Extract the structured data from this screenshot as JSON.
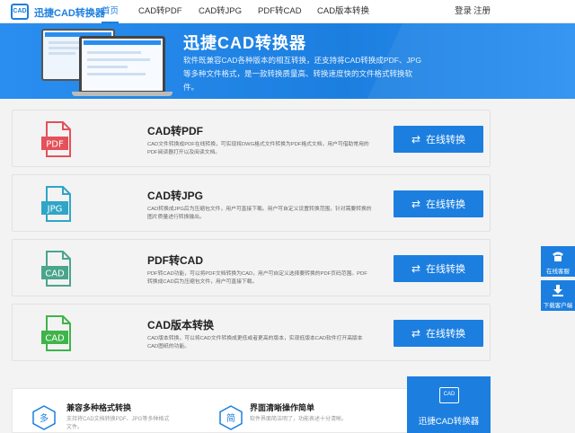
{
  "nav": {
    "logo_icon": "CAD",
    "logo_text": "迅捷CAD转换器",
    "items": [
      {
        "label": "首页",
        "active": true
      },
      {
        "label": "CAD转PDF"
      },
      {
        "label": "CAD转JPG"
      },
      {
        "label": "PDF转CAD"
      },
      {
        "label": "CAD版本转换"
      }
    ],
    "login": "登录",
    "register": "注册"
  },
  "hero": {
    "title": "迅捷CAD转换器",
    "description": "软件既兼容CAD各种版本的相互转换，还支持将CAD转换成PDF、JPG等多种文件格式，是一款转换质量高、转换速度快的文件格式转换软件。"
  },
  "cards": [
    {
      "icon_label": "PDF",
      "icon_color": "#e5505a",
      "title": "CAD转PDF",
      "description": "CAD文件转换成PDF在线转换，可实现将DWG格式文件转换为PDF格式文档，用户可借助常用的PDF阅读器打开以及阅读文档。",
      "button": "在线转换"
    },
    {
      "icon_label": "JPG",
      "icon_color": "#2fa6c6",
      "title": "CAD转JPG",
      "description": "CAD转换成JPG后为压缩包文件，用户可直接下载。用户可自定义设置转换范围，针对需要转换的图片质量进行转换输出。",
      "button": "在线转换"
    },
    {
      "icon_label": "CAD",
      "icon_color": "#4aa58c",
      "title": "PDF转CAD",
      "description": "PDF转CAD功能，可以将PDF文档转换为CAD，用户可自定义选择要转换的PDF页码范围。PDF转换成CAD后为压缩包文件，用户可直接下载。",
      "button": "在线转换"
    },
    {
      "icon_label": "CAD",
      "icon_color": "#3fb44a",
      "title": "CAD版本转换",
      "description": "CAD版本转换，可以将CAD文件转换成更低或者更高的版本，实现低版本CAD软件打开高版本CAD图纸的功能。",
      "button": "在线转换"
    }
  ],
  "features": [
    {
      "badge": "多",
      "title": "兼容多种格式转换",
      "description": "支持将CAD文档转换PDF、JPG等多种格式文件。"
    },
    {
      "badge": "简",
      "title": "界面清晰操作简单",
      "description": "软件界面简洁明了，功能表述十分清晰。"
    }
  ],
  "promo": {
    "icon": "CAD",
    "label": "迅捷CAD转换器"
  },
  "side_tools": [
    {
      "icon": "phone-icon",
      "label": "在线客服"
    },
    {
      "icon": "download-icon",
      "label": "下载客户端"
    }
  ],
  "colors": {
    "accent": "#1c7fe0"
  }
}
